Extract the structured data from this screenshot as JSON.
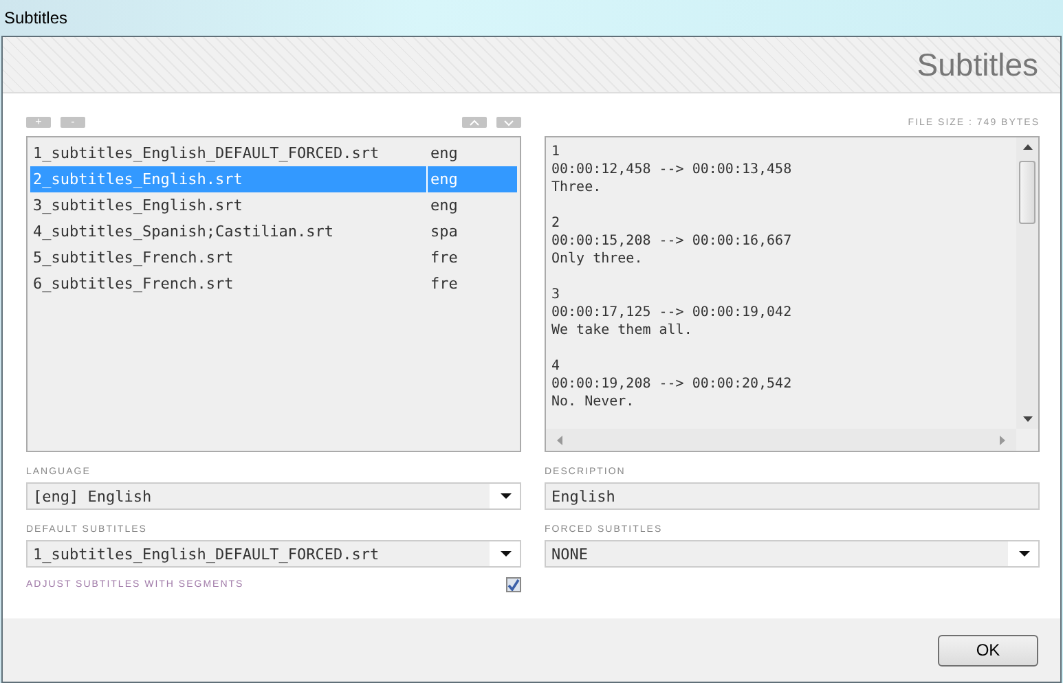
{
  "window": {
    "title": "Subtitles"
  },
  "header": {
    "title": "Subtitles"
  },
  "list_toolbar": {
    "add": "+",
    "remove": "-"
  },
  "file_size": "FILE SIZE : 749 BYTES",
  "files": [
    {
      "name": "1_subtitles_English_DEFAULT_FORCED.srt",
      "lang": "eng",
      "selected": false
    },
    {
      "name": "2_subtitles_English.srt",
      "lang": "eng",
      "selected": true
    },
    {
      "name": "3_subtitles_English.srt",
      "lang": "eng",
      "selected": false
    },
    {
      "name": "4_subtitles_Spanish;Castilian.srt",
      "lang": "spa",
      "selected": false
    },
    {
      "name": "5_subtitles_French.srt",
      "lang": "fre",
      "selected": false
    },
    {
      "name": "6_subtitles_French.srt",
      "lang": "fre",
      "selected": false
    }
  ],
  "preview": [
    {
      "index": "1",
      "time": "00:00:12,458 --> 00:00:13,458",
      "text": "Three."
    },
    {
      "index": "2",
      "time": "00:00:15,208 --> 00:00:16,667",
      "text": "Only three."
    },
    {
      "index": "3",
      "time": "00:00:17,125 --> 00:00:19,042",
      "text": "We take them all."
    },
    {
      "index": "4",
      "time": "00:00:19,208 --> 00:00:20,542",
      "text": "No. Never."
    }
  ],
  "language": {
    "label": "LANGUAGE",
    "value": "[eng] English"
  },
  "description": {
    "label": "DESCRIPTION",
    "value": "English"
  },
  "default_subtitles": {
    "label": "DEFAULT SUBTITLES",
    "value": "1_subtitles_English_DEFAULT_FORCED.srt"
  },
  "forced_subtitles": {
    "label": "FORCED SUBTITLES",
    "value": "NONE"
  },
  "adjust": {
    "label": "ADJUST  SUBTITLES WITH SEGMENTS",
    "checked": true
  },
  "buttons": {
    "ok": "OK"
  }
}
